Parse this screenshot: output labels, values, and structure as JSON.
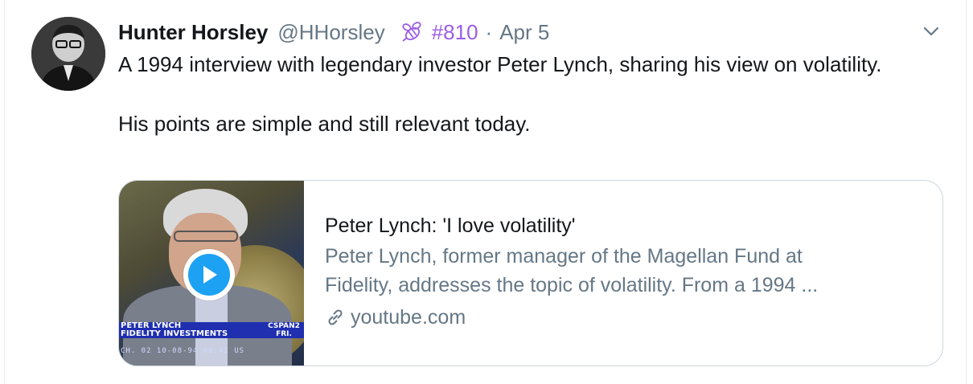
{
  "tweet": {
    "author_name": "Hunter Horsley",
    "handle": "@HHorsley",
    "hashtag": "#810",
    "separator": "·",
    "date": "Apr 5",
    "text_paragraphs": [
      "A 1994 interview with legendary investor Peter Lynch, sharing his view on volatility.",
      "His points are simple and still relevant today."
    ]
  },
  "card": {
    "title": "Peter Lynch: 'I love volatility'",
    "description_lines": [
      "Peter Lynch, former manager of the Magellan Fund at",
      "Fidelity, addresses the topic of volatility. From a 1994 ..."
    ],
    "domain": "youtube.com",
    "thumbnail": {
      "lower_third_lines": [
        "PETER LYNCH",
        "FIDELITY INVESTMENTS"
      ],
      "network_lines": [
        "CSPAN2",
        "FRI."
      ],
      "timestamp": "CH. 02   10-08-94   06:42 US"
    }
  },
  "icons": {
    "bee": "bee-icon",
    "chevron": "chevron-down-icon",
    "play": "play-icon",
    "link": "link-icon"
  },
  "colors": {
    "hashtag": "#9b5de5",
    "play_button": "#1da1f2",
    "muted_text": "#657786"
  }
}
